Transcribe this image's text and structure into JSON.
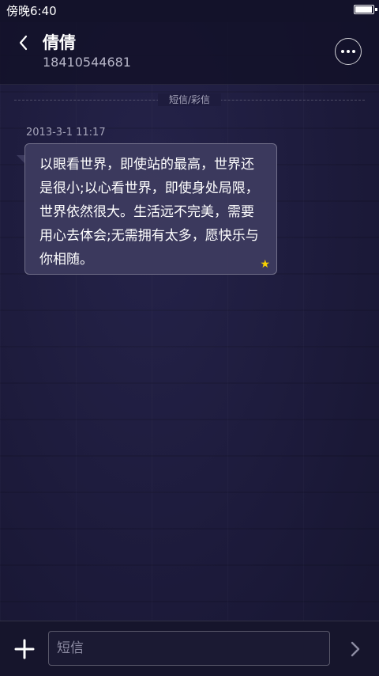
{
  "status_bar": {
    "time": "傍晚6:40",
    "battery_level": 0.95
  },
  "header": {
    "contact_name": "倩倩",
    "phone_number": "18410544681",
    "back_icon": "chevron-left-icon",
    "more_icon": "more-horizontal-icon"
  },
  "conversation": {
    "channel_label": "短信/彩信",
    "messages": [
      {
        "timestamp": "2013-3-1 11:17",
        "text": "以眼看世界，即使站的最高，世界还是很小;以心看世界，即使身处局限，世界依然很大。生活远不完美，需要用心去体会;无需拥有太多，愿快乐与你相随。",
        "starred_icon": "star-icon"
      }
    ]
  },
  "input_bar": {
    "placeholder": "短信",
    "add_icon": "plus-icon",
    "send_icon": "chevron-right-icon"
  },
  "colors": {
    "background": "#1d1b3c",
    "bubble": "#3e3c60",
    "star": "#f5d000",
    "secondary_text": "#b7b6c8"
  }
}
